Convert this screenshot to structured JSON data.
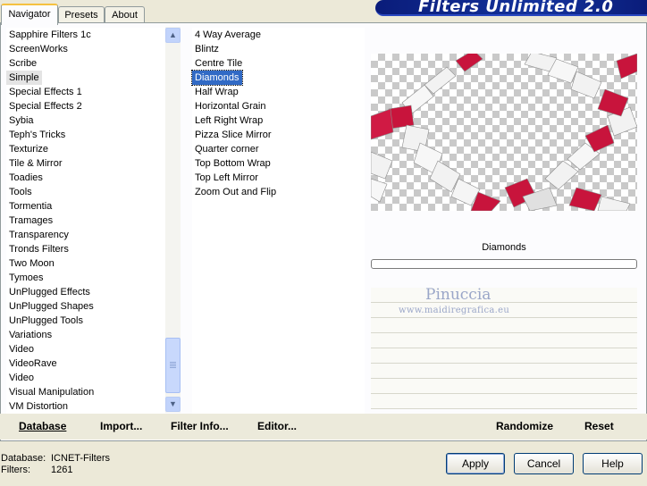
{
  "tabs": {
    "navigator": "Navigator",
    "presets": "Presets",
    "about": "About"
  },
  "banner": {
    "title": "Filters Unlimited 2.0"
  },
  "categories": [
    "Sapphire Filters 1c",
    "ScreenWorks",
    "Scribe",
    "Simple",
    "Special Effects 1",
    "Special Effects 2",
    "Sybia",
    "Teph's Tricks",
    "Texturize",
    "Tile & Mirror",
    "Toadies",
    "Tools",
    "Tormentia",
    "Tramages",
    "Transparency",
    "Tronds Filters",
    "Two Moon",
    "Tymoes",
    "UnPlugged Effects",
    "UnPlugged Shapes",
    "UnPlugged Tools",
    "Variations",
    "Video",
    "VideoRave",
    "Video",
    "Visual Manipulation",
    "VM Distortion"
  ],
  "selected_category": "Simple",
  "filters": [
    "4 Way Average",
    "Blintz",
    "Centre Tile",
    "Diamonds",
    "Half Wrap",
    "Horizontal Grain",
    "Left Right Wrap",
    "Pizza Slice Mirror",
    "Quarter corner",
    "Top Bottom Wrap",
    "Top Left Mirror",
    "Zoom Out and Flip"
  ],
  "selected_filter": "Diamonds",
  "filter_name": "Diamonds",
  "watermark": {
    "name": "Pinuccia",
    "url": "www.maidiregrafica.eu"
  },
  "toolbar": {
    "database": "Database",
    "import": "Import...",
    "filter_info": "Filter Info...",
    "editor": "Editor...",
    "randomize": "Randomize",
    "reset": "Reset"
  },
  "info": {
    "database_label": "Database:",
    "database_value": "ICNET-Filters",
    "filters_label": "Filters:",
    "filters_value": "1261"
  },
  "buttons": {
    "apply": "Apply",
    "cancel": "Cancel",
    "help": "Help"
  },
  "colors": {
    "selection": "#316ac5",
    "banner": "#0a1c7a",
    "preview_red": "#c8143c"
  },
  "scrollbar": {
    "position_fraction": 0.86
  }
}
